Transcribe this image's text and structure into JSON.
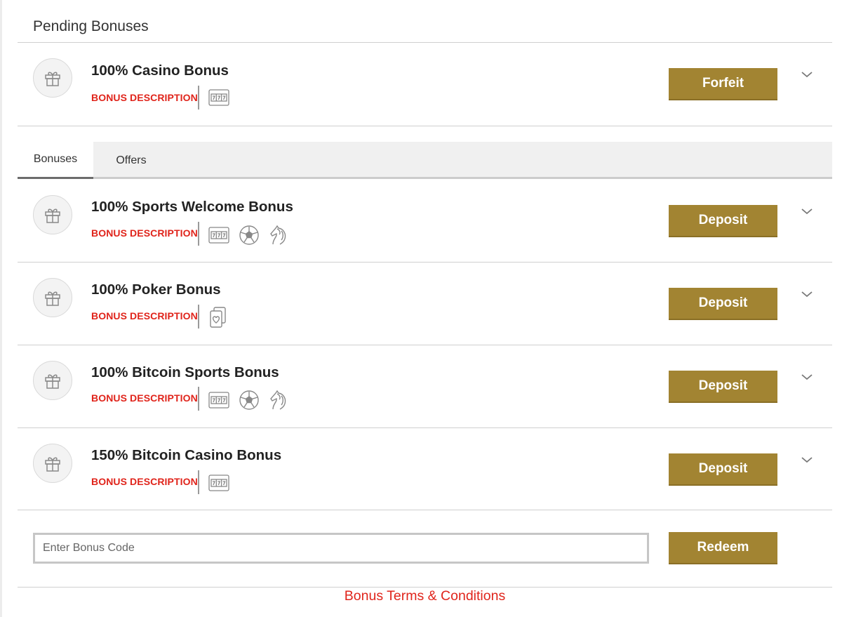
{
  "pending": {
    "title": "Pending Bonuses",
    "item": {
      "title": "100% Casino Bonus",
      "description": "BONUS DESCRIPTION",
      "games": [
        "slots-icon"
      ],
      "action_label": "Forfeit"
    }
  },
  "tabs": [
    {
      "label": "Bonuses",
      "active": true
    },
    {
      "label": "Offers",
      "active": false
    }
  ],
  "bonuses": [
    {
      "title": "100% Sports Welcome Bonus",
      "description": "BONUS DESCRIPTION",
      "games": [
        "slots-icon",
        "soccer-ball-icon",
        "horse-icon"
      ],
      "action_label": "Deposit"
    },
    {
      "title": "100% Poker Bonus",
      "description": "BONUS DESCRIPTION",
      "games": [
        "playing-cards-icon"
      ],
      "action_label": "Deposit"
    },
    {
      "title": "100% Bitcoin Sports Bonus",
      "description": "BONUS DESCRIPTION",
      "games": [
        "slots-icon",
        "soccer-ball-icon",
        "horse-icon"
      ],
      "action_label": "Deposit"
    },
    {
      "title": "150% Bitcoin Casino Bonus",
      "description": "BONUS DESCRIPTION",
      "games": [
        "slots-icon"
      ],
      "action_label": "Deposit"
    }
  ],
  "bonus_code": {
    "placeholder": "Enter Bonus Code",
    "value": "",
    "button_label": "Redeem"
  },
  "terms_link": "Bonus Terms & Conditions",
  "colors": {
    "accent_gold": "#a28432",
    "description_red": "#e0241b",
    "link_red": "#e0241b"
  }
}
